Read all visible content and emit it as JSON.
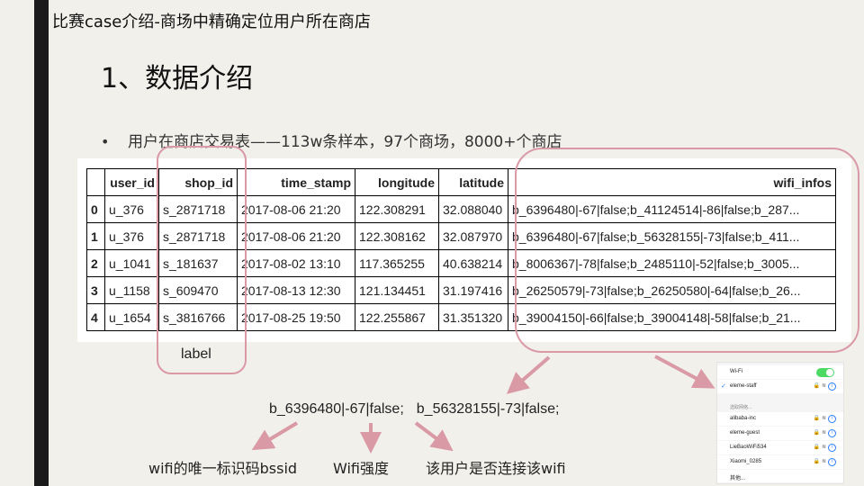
{
  "slide": {
    "top_title": "比赛case介绍-商场中精确定位用户所在商店",
    "heading": "1、数据介绍",
    "bullet_symbol": "•",
    "bullet_text": "用户在商店交易表——113w条样本，97个商场，8000+个商店"
  },
  "table": {
    "columns": [
      "",
      "user_id",
      "shop_id",
      "time_stamp",
      "longitude",
      "latitude",
      "wifi_infos"
    ],
    "rows": [
      [
        "0",
        "u_376",
        "s_2871718",
        "2017-08-06 21:20",
        "122.308291",
        "32.088040",
        "b_6396480|-67|false;b_41124514|-86|false;b_287..."
      ],
      [
        "1",
        "u_376",
        "s_2871718",
        "2017-08-06 21:20",
        "122.308162",
        "32.087970",
        "b_6396480|-67|false;b_56328155|-73|false;b_411..."
      ],
      [
        "2",
        "u_1041",
        "s_181637",
        "2017-08-02 13:10",
        "117.365255",
        "40.638214",
        "b_8006367|-78|false;b_2485110|-52|false;b_3005..."
      ],
      [
        "3",
        "u_1158",
        "s_609470",
        "2017-08-13 12:30",
        "121.134451",
        "31.197416",
        "b_26250579|-73|false;b_26250580|-64|false;b_26..."
      ],
      [
        "4",
        "u_1654",
        "s_3816766",
        "2017-08-25 19:50",
        "122.255867",
        "31.351320",
        "b_39004150|-66|false;b_39004148|-58|false;b_21..."
      ]
    ]
  },
  "annotations": {
    "shop_label": "label",
    "example_part1": "b_6396480|-67|false;",
    "example_part2": "b_56328155|-73|false;",
    "bssid_note": "wifi的唯一标识码bssid",
    "strength_note": "Wifi强度",
    "connected_note": "该用户是否连接该wifi"
  },
  "phone": {
    "wifi_label": "Wi-Fi",
    "connected_network": "eleme-staff",
    "section_label": "选取网络...",
    "networks": [
      "alibaba-inc",
      "eleme-guest",
      "LieBaoWiFi534",
      "Xiaomi_0285"
    ],
    "other": "其他..."
  },
  "colors": {
    "highlight": "#d99aa6",
    "toggle_on": "#4cd964",
    "info_blue": "#2a7cf7"
  }
}
